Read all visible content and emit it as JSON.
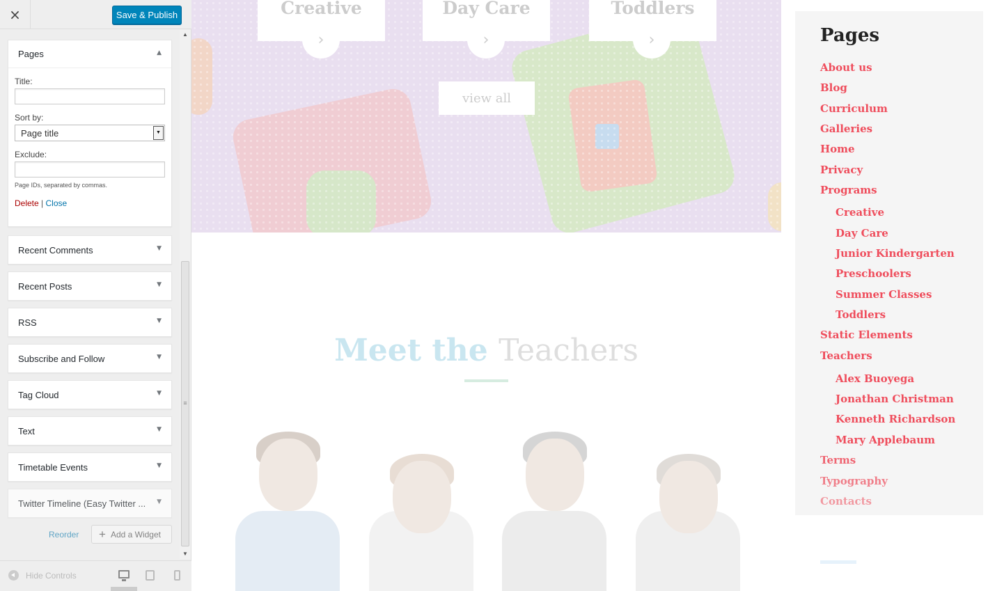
{
  "panel": {
    "close_icon": "×",
    "publish_label": "Save & Publish",
    "pages_widget": {
      "title": "Pages",
      "title_label": "Title:",
      "title_value": "",
      "sort_label": "Sort by:",
      "sort_value": "Page title",
      "exclude_label": "Exclude:",
      "exclude_value": "",
      "hint": "Page IDs, separated by commas.",
      "delete_label": "Delete",
      "separator": "|",
      "close_label": "Close"
    },
    "widgets": [
      {
        "title": "Recent Comments"
      },
      {
        "title": "Recent Posts"
      },
      {
        "title": "RSS"
      },
      {
        "title": "Subscribe and Follow"
      },
      {
        "title": "Tag Cloud"
      },
      {
        "title": "Text"
      },
      {
        "title": "Timetable Events"
      },
      {
        "title": "Twitter Timeline (Easy Twitter ..."
      }
    ],
    "reorder_label": "Reorder",
    "add_widget_label": "Add a Widget",
    "hide_controls_label": "Hide Controls"
  },
  "preview": {
    "categories": [
      "Creative",
      "Day Care",
      "Toddlers"
    ],
    "view_all_label": "view all",
    "meet_heading_a": "Meet the",
    "meet_heading_b": "Teachers",
    "sidebar": {
      "title": "Pages",
      "pages": [
        {
          "label": "About us",
          "level": 0
        },
        {
          "label": "Blog",
          "level": 0
        },
        {
          "label": "Curriculum",
          "level": 0
        },
        {
          "label": "Galleries",
          "level": 0
        },
        {
          "label": "Home",
          "level": 0
        },
        {
          "label": "Privacy",
          "level": 0
        },
        {
          "label": "Programs",
          "level": 0
        },
        {
          "label": "Creative",
          "level": 1
        },
        {
          "label": "Day Care",
          "level": 1
        },
        {
          "label": "Junior Kindergarten",
          "level": 1
        },
        {
          "label": "Preschoolers",
          "level": 1
        },
        {
          "label": "Summer Classes",
          "level": 1
        },
        {
          "label": "Toddlers",
          "level": 1
        },
        {
          "label": "Static Elements",
          "level": 0
        },
        {
          "label": "Teachers",
          "level": 0
        },
        {
          "label": "Alex Buoyega",
          "level": 1
        },
        {
          "label": "Jonathan Christman",
          "level": 1
        },
        {
          "label": "Kenneth Richardson",
          "level": 1
        },
        {
          "label": "Mary Applebaum",
          "level": 1
        },
        {
          "label": "Terms",
          "level": 0
        },
        {
          "label": "Typography",
          "level": 0
        },
        {
          "label": "Contacts",
          "level": 0
        }
      ]
    }
  },
  "colors": {
    "publish_blue": "#0085ba",
    "link_red": "#ef4d5c",
    "delete_red": "#aa0000",
    "close_blue": "#0073aa"
  }
}
